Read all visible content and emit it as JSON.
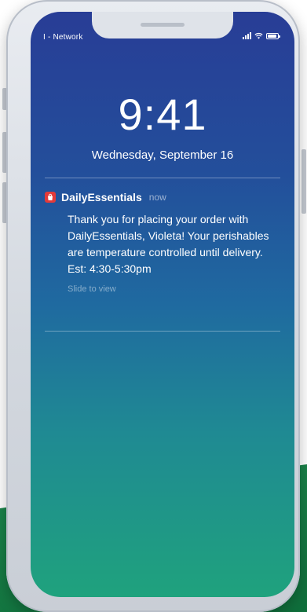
{
  "status_bar": {
    "carrier": "I - Network"
  },
  "lock_screen": {
    "time": "9:41",
    "date": "Wednesday, September 16"
  },
  "notification": {
    "app_name": "DailyEssentials",
    "time": "now",
    "message": "Thank you for placing your order with DailyEssentials, Violeta! Your perishables are temperature controlled until delivery. Est: 4:30-5:30pm",
    "hint": "Slide to view",
    "icon": "shopping-bag-icon",
    "icon_color": "#e23a3a"
  },
  "colors": {
    "screen_top": "#283d96",
    "screen_bottom": "#1fa27d",
    "backdrop_green": "#1f8a4f"
  }
}
